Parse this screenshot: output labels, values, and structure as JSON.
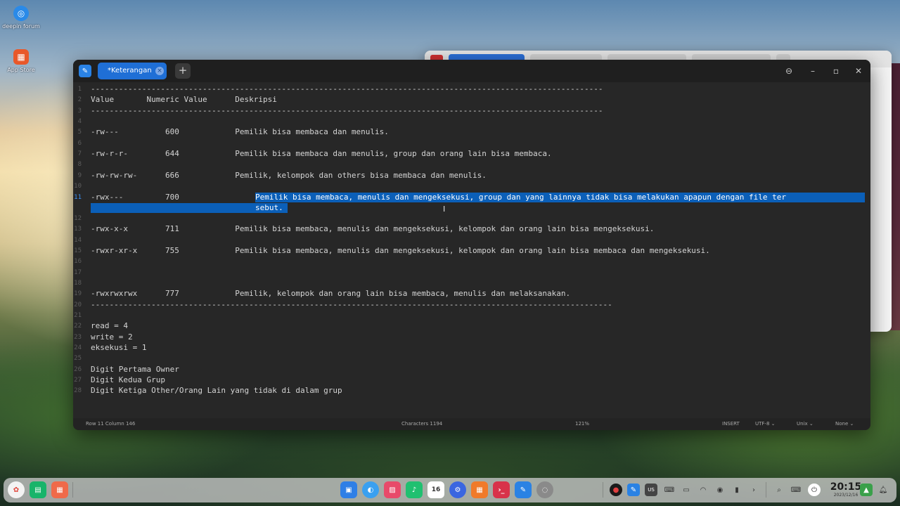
{
  "desktop": {
    "icons": [
      {
        "label": "deepin forum",
        "icon": "deepin-forum-icon"
      },
      {
        "label": "App Store",
        "icon": "app-store-icon"
      }
    ]
  },
  "editor": {
    "tab_label": "*Keterangan.t",
    "tab_close": "×",
    "add_tab": "+",
    "controls": {
      "menu": "⊖",
      "minimize": "–",
      "maximize": "▫",
      "close": "✕"
    },
    "lines": [
      {
        "n": "1",
        "text": "--------------------------------------------------------------------------------------------------------------"
      },
      {
        "n": "2",
        "text": "Value       Numeric Value      Deskripsi"
      },
      {
        "n": "3",
        "text": "--------------------------------------------------------------------------------------------------------------"
      },
      {
        "n": "4",
        "text": ""
      },
      {
        "n": "5",
        "text": "-rw---          600            Pemilik bisa membaca dan menulis."
      },
      {
        "n": "6",
        "text": ""
      },
      {
        "n": "7",
        "text": "-rw-r-r-        644            Pemilik bisa membaca dan menulis, group dan orang lain bisa membaca."
      },
      {
        "n": "8",
        "text": ""
      },
      {
        "n": "9",
        "text": "-rw-rw-rw-      666            Pemilik, kelompok dan others bisa membaca dan menulis."
      },
      {
        "n": "10",
        "text": ""
      },
      {
        "n": "11",
        "text": "-rwx---         700            "
      },
      {
        "n": "12",
        "text": ""
      },
      {
        "n": "13",
        "text": "-rwx-x-x        711            Pemilik bisa membaca, menulis dan mengeksekusi, kelompok dan orang lain bisa mengeksekusi."
      },
      {
        "n": "14",
        "text": ""
      },
      {
        "n": "15",
        "text": "-rwxr-xr-x      755            Pemilik bisa membaca, menulis dan mengeksekusi, kelompok dan orang lain bisa membaca dan mengeksekusi."
      },
      {
        "n": "16",
        "text": ""
      },
      {
        "n": "17",
        "text": ""
      },
      {
        "n": "18",
        "text": ""
      },
      {
        "n": "19",
        "text": "-rwxrwxrwx      777            Pemilik, kelompok dan orang lain bisa membaca, menulis dan melaksanakan."
      },
      {
        "n": "20",
        "text": "----------------------------------------------------------------------------------------------------------------"
      },
      {
        "n": "21",
        "text": ""
      },
      {
        "n": "22",
        "text": "read = 4"
      },
      {
        "n": "23",
        "text": "write = 2"
      },
      {
        "n": "24",
        "text": "eksekusi = 1"
      },
      {
        "n": "25",
        "text": ""
      },
      {
        "n": "26",
        "text": "Digit Pertama Owner"
      },
      {
        "n": "27",
        "text": "Digit Kedua Grup"
      },
      {
        "n": "28",
        "text": "Digit Ketiga Other/Orang Lain yang tidak di dalam grup"
      }
    ],
    "selection": {
      "line1": "Pemilik bisa membaca, menulis dan mengeksekusi, group dan yang lainnya tidak bisa melakukan apapun dengan file ter",
      "line2": "sebut."
    },
    "status": {
      "position": "Row 11  Column 146",
      "characters": "Characters 1194",
      "zoom": "121%",
      "mode": "INSERT",
      "encoding": "UTF-8 ⌄",
      "line_ending": "Unix ⌄",
      "highlight": "None ⌄"
    }
  },
  "dock": {
    "calendar_day": "16",
    "keyboard_layout": "US",
    "time": "20:15",
    "date": "2023/12/16"
  }
}
